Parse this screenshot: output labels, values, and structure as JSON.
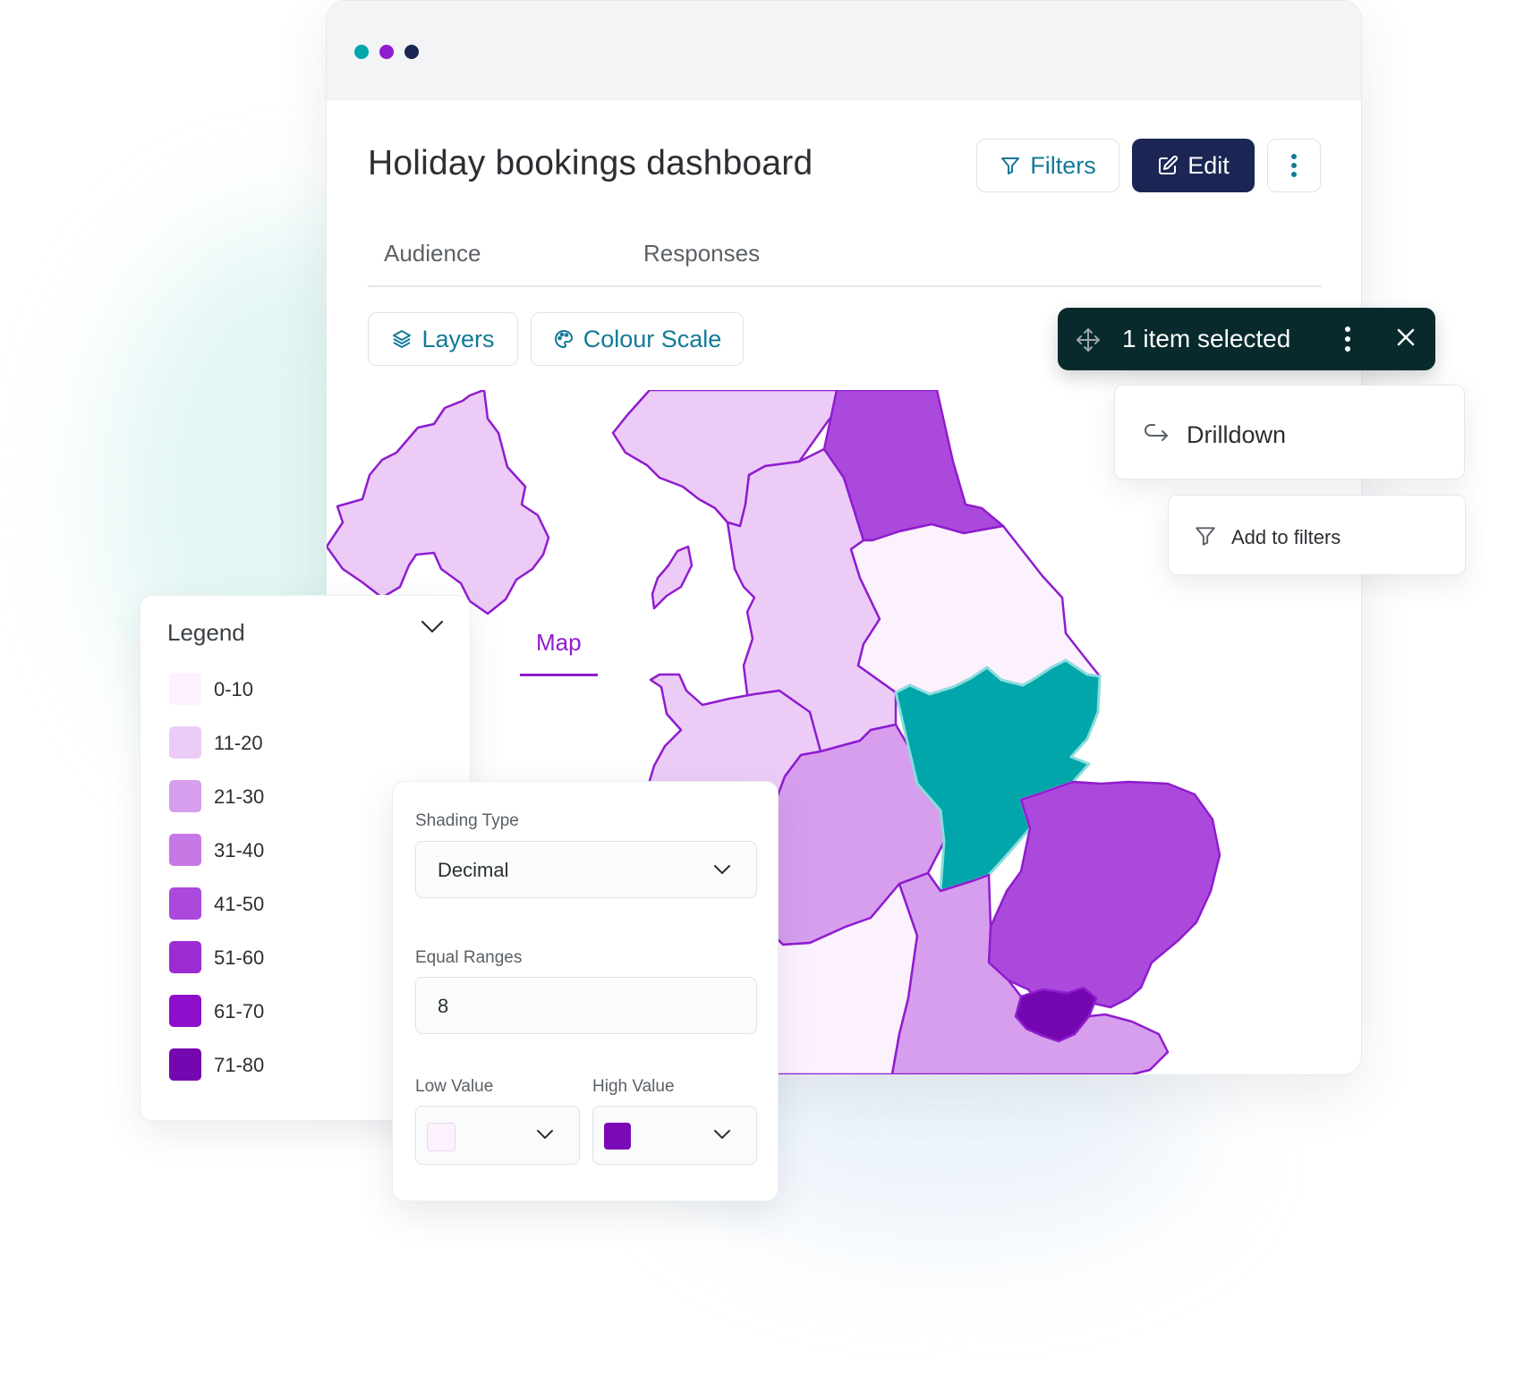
{
  "header": {
    "title": "Holiday bookings dashboard",
    "filters_label": "Filters",
    "edit_label": "Edit"
  },
  "tabs": [
    {
      "label": "Audience",
      "active": false
    },
    {
      "label": "Map",
      "active": true
    },
    {
      "label": "Responses",
      "active": false
    }
  ],
  "toolbar": {
    "layers_label": "Layers",
    "colour_scale_label": "Colour Scale"
  },
  "selection": {
    "text": "1 item selected"
  },
  "context_menu": {
    "drilldown_label": "Drilldown",
    "add_filters_label": "Add to filters"
  },
  "legend": {
    "title": "Legend",
    "items": [
      {
        "range": "0-10",
        "color": "#fcf2fd"
      },
      {
        "range": "11-20",
        "color": "#ecccf7"
      },
      {
        "range": "21-30",
        "color": "#d79eee"
      },
      {
        "range": "31-40",
        "color": "#c678e4"
      },
      {
        "range": "41-50",
        "color": "#ab49dd"
      },
      {
        "range": "51-60",
        "color": "#9d2bd3"
      },
      {
        "range": "61-70",
        "color": "#8e0fcb"
      },
      {
        "range": "71-80",
        "color": "#7507b0"
      }
    ]
  },
  "colour_scale": {
    "shading_type_label": "Shading Type",
    "shading_type_value": "Decimal",
    "equal_ranges_label": "Equal Ranges",
    "equal_ranges_value": "8",
    "low_value_label": "Low Value",
    "low_value_color": "#fcf2fd",
    "high_value_label": "High Value",
    "high_value_color": "#7a09b6"
  },
  "colors": {
    "accent_purple": "#8f1ccf",
    "accent_teal_text": "#127a98",
    "navy": "#1b2654",
    "selected_region": "#00a6aa"
  }
}
